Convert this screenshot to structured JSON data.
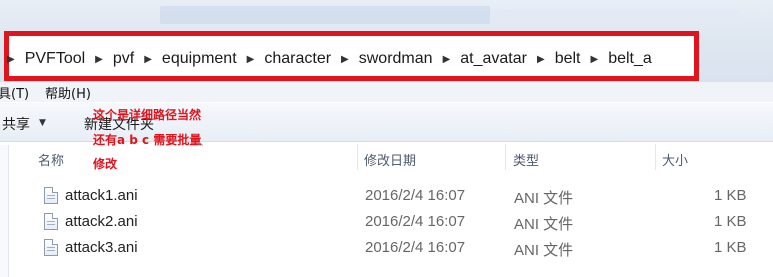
{
  "address_bar": {
    "crumbs": [
      "PVFTool",
      "pvf",
      "equipment",
      "character",
      "swordman",
      "at_avatar",
      "belt",
      "belt_a"
    ]
  },
  "menu": {
    "partial_tools": "具(T)",
    "help": "帮助(H)"
  },
  "toolbar": {
    "share": "共享",
    "new_folder": "新建文件夹"
  },
  "annotation": {
    "line1": "这个是详细路径当然",
    "line2": "还有a b c 需要批量",
    "line3": "修改"
  },
  "columns": {
    "name": "名称",
    "modified": "修改日期",
    "type": "类型",
    "size": "大小"
  },
  "files": [
    {
      "name": "attack1.ani",
      "modified": "2016/2/4 16:07",
      "type": "ANI 文件",
      "size": "1 KB"
    },
    {
      "name": "attack2.ani",
      "modified": "2016/2/4 16:07",
      "type": "ANI 文件",
      "size": "1 KB"
    },
    {
      "name": "attack3.ani",
      "modified": "2016/2/4 16:07",
      "type": "ANI 文件",
      "size": "1 KB"
    }
  ],
  "colors": {
    "annotation_red": "#e0141d"
  }
}
